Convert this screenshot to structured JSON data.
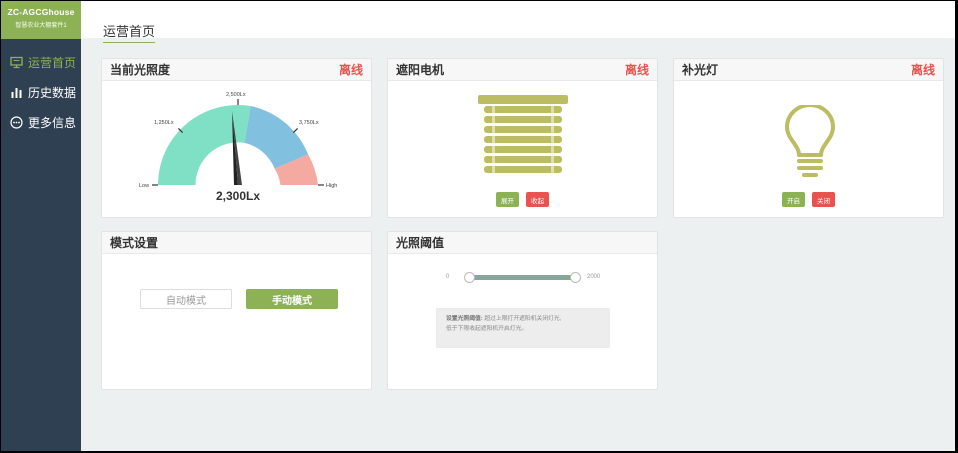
{
  "app": {
    "title": "ZC-AGCGhouse",
    "subtitle": "智慧农业大棚套件1"
  },
  "nav": [
    {
      "label": "运营首页",
      "icon": "monitor-icon"
    },
    {
      "label": "历史数据",
      "icon": "bar-chart-icon"
    },
    {
      "label": "更多信息",
      "icon": "more-icon"
    }
  ],
  "page": {
    "title": "运营首页"
  },
  "light": {
    "title": "当前光照度",
    "status": "离线",
    "reading": "2,300Lx",
    "value": 2300,
    "ticks": [
      "Low",
      "1,250Lx",
      "2,500Lx",
      "3,750Lx",
      "High"
    ]
  },
  "motor": {
    "title": "遮阳电机",
    "status": "离线",
    "open_label": "展开",
    "close_label": "收起"
  },
  "lamp": {
    "title": "补光灯",
    "status": "离线",
    "on_label": "开启",
    "off_label": "关闭"
  },
  "mode": {
    "title": "模式设置",
    "auto_label": "自动模式",
    "manual_label": "手动模式"
  },
  "threshold": {
    "title": "光照阈值",
    "min": "0",
    "max": "2000",
    "tip_title": "设置光照阈值:",
    "tip_line1": "超过上限打开遮阳机关闭灯光,",
    "tip_line2": "低于下限收起遮阳机开启灯光。"
  },
  "colors": {
    "accent": "#8db255",
    "sidebar": "#2f4053",
    "offline": "#e9534f",
    "gauge_low": "#7fe0c6",
    "gauge_mid": "#82c0e0",
    "gauge_high": "#f4aaa0",
    "icon_olive": "#bcbc62"
  }
}
